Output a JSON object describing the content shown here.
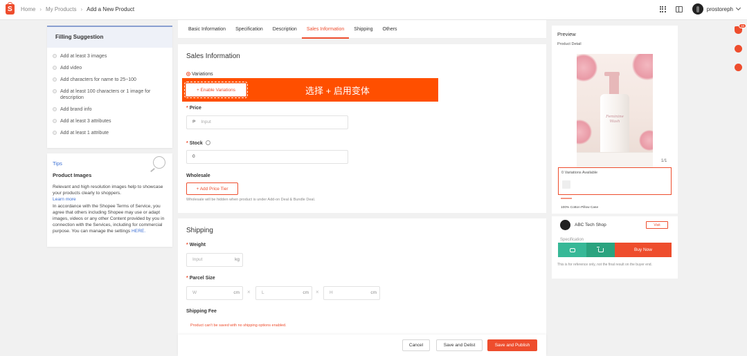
{
  "header": {
    "logo_letter": "S",
    "breadcrumb": [
      "Home",
      "My Products",
      "Add a New Product"
    ],
    "username": "prostoreph"
  },
  "filling_suggestion": {
    "title": "Filling Suggestion",
    "items": [
      "Add at least 3 images",
      "Add video",
      "Add characters for name to 25~100",
      "Add at least 100 characters or 1 image for description",
      "Add brand info",
      "Add at least 3 attributes",
      "Add at least 1 attribute"
    ]
  },
  "tips": {
    "title": "Tips",
    "heading": "Product Images",
    "body_1": "Relevant and high resolution images help to showcase your products clearly to shoppers.",
    "learn_more": "Learn more",
    "body_2": "In accordance with the Shopee Terms of Service, you agree that others including Shopee may use or adapt images, videos or any other Content provided by you in connection with the Services, including for commercial purpose. You can manage the settings",
    "here": "HERE."
  },
  "tabs": [
    "Basic Information",
    "Specification",
    "Description",
    "Sales Information",
    "Shipping",
    "Others"
  ],
  "active_tab": "Sales Information",
  "sales": {
    "title": "Sales Information",
    "variations_label": "Variations",
    "enable_variations": "+ Enable Variations",
    "banner_text": "选择 + 启用变体",
    "price_label": "Price",
    "price_placeholder": "Input",
    "currency_symbol": "₱",
    "stock_label": "Stock",
    "stock_value": "0",
    "wholesale_label": "Wholesale",
    "add_price_tier": "+ Add Price Tier",
    "wholesale_hint": "Wholesale will be hidden when product is under Add-on Deal & Bundle Deal."
  },
  "shipping": {
    "title": "Shipping",
    "weight_label": "Weight",
    "weight_placeholder": "Input",
    "weight_unit": "kg",
    "parcel_label": "Parcel Size",
    "w_placeholder": "W",
    "l_placeholder": "L",
    "h_placeholder": "H",
    "dim_unit": "cm",
    "fee_label": "Shipping Fee",
    "error": "Product can't be saved with no shipping options enabled."
  },
  "footer": {
    "cancel": "Cancel",
    "save_delist": "Save and Delist",
    "save_publish": "Save and Publish"
  },
  "preview": {
    "title": "Preview",
    "subtitle": "Product Detail",
    "image_text": "Feminine Wash",
    "counter": "1/1",
    "variations_available": "0 Variations Available",
    "price_placeholder": "₱--",
    "product_name": "100% Cotton Pillow Case",
    "shop_name": "ABC Tech Shop",
    "visit": "Visit",
    "spec_peek": "Specification",
    "buy_now": "Buy Now",
    "disclaimer": "This is for reference only, not the final result on the buyer end."
  },
  "float": {
    "badge_count": "16"
  },
  "colors": {
    "accent": "#ee4d2d",
    "banner": "#ff4f00",
    "chat_green": "#37b897",
    "link": "#3b6fd4"
  }
}
